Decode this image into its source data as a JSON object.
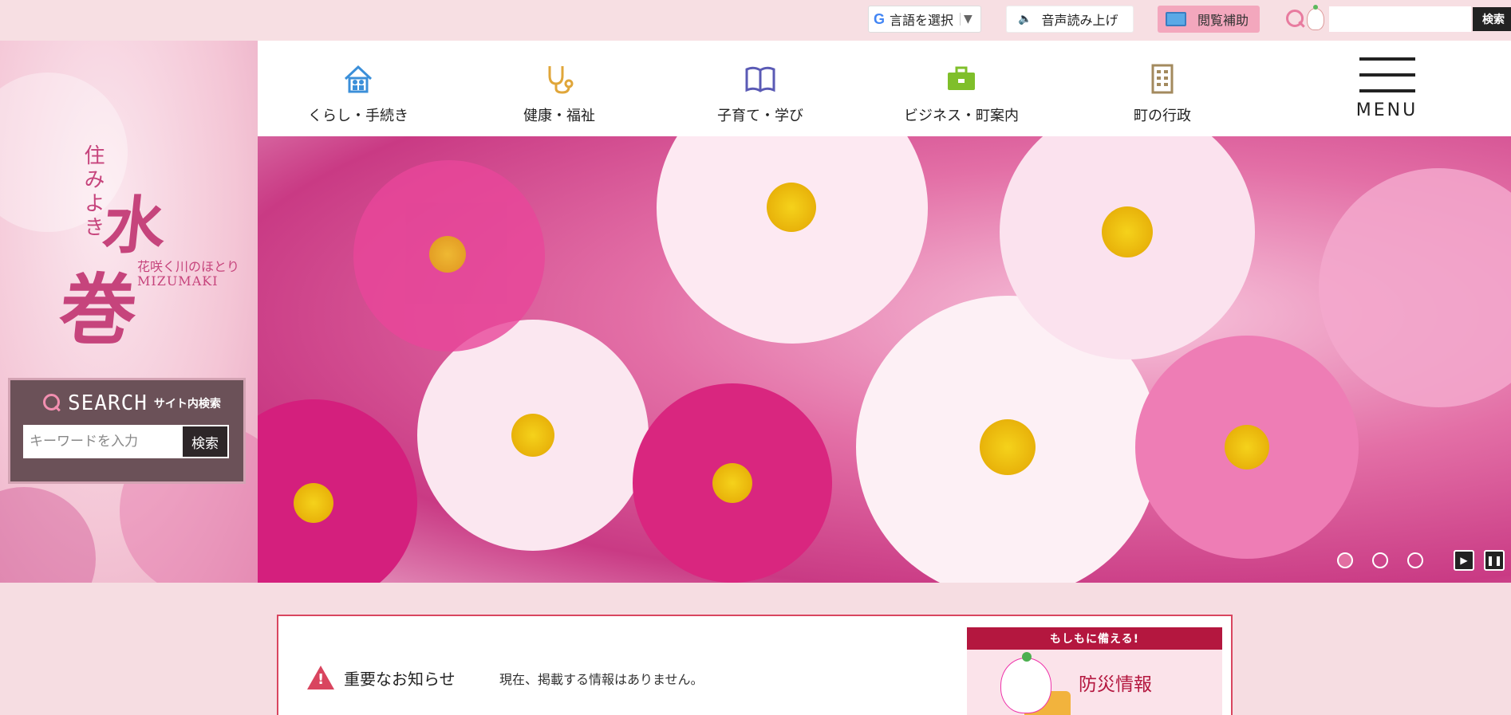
{
  "topbar": {
    "language_label": "言語を選択",
    "language_arrow": "▼",
    "voice_label": "音声読み上げ",
    "assist_label": "閲覧補助",
    "search_button": "検索"
  },
  "logo": {
    "vertical_text": "住みよき",
    "kanji_top": "水",
    "kanji_bottom": "巻",
    "tagline": "花咲く川のほとり",
    "english": "MIZUMAKI"
  },
  "side_search": {
    "title": "SEARCH",
    "subtitle": "サイト内検索",
    "placeholder": "キーワードを入力",
    "button": "検索"
  },
  "nav": {
    "items": [
      {
        "label": "くらし・手続き",
        "icon": "house-family-icon"
      },
      {
        "label": "健康・福祉",
        "icon": "stethoscope-icon"
      },
      {
        "label": "子育て・学び",
        "icon": "book-icon"
      },
      {
        "label": "ビジネス・町案内",
        "icon": "briefcase-icon"
      },
      {
        "label": "町の行政",
        "icon": "building-icon"
      }
    ],
    "menu_label": "MENU"
  },
  "slider": {
    "slide_count": 3,
    "active_slide": 1,
    "play_symbol": "▶",
    "pause_symbol": "❚❚"
  },
  "notice": {
    "title": "重要なお知らせ",
    "message": "現在、掲載する情報はありません。"
  },
  "bosai": {
    "header": "もしもに備える!",
    "title": "防災情報"
  },
  "colors": {
    "accent_pink": "#e87b9f",
    "brand_magenta": "#c6447c",
    "alert_red": "#d9455f",
    "bosai_red": "#b4173f"
  }
}
